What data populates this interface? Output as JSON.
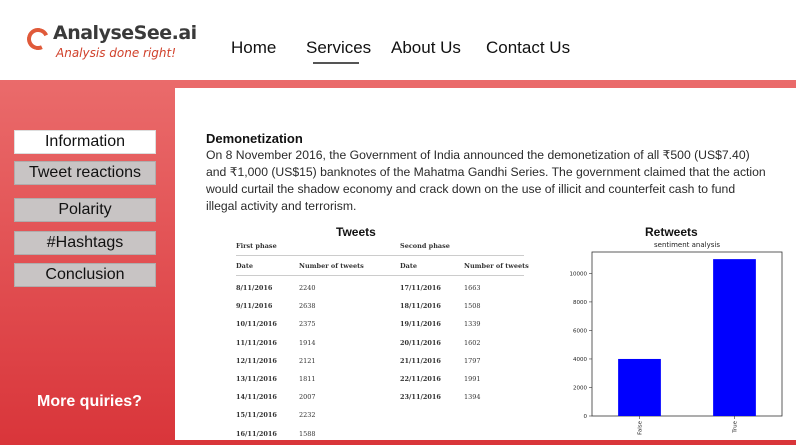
{
  "brand": {
    "name": "AnalyseSee.ai",
    "tagline": "Analysis done right!"
  },
  "nav": {
    "home": "Home",
    "services": "Services",
    "about": "About Us",
    "contact": "Contact Us",
    "active": "Services"
  },
  "sidebar": {
    "items": [
      {
        "label": "Information",
        "active": true
      },
      {
        "label": "Tweet reactions",
        "active": false
      },
      {
        "label": "Polarity",
        "active": false
      },
      {
        "label": "#Hashtags",
        "active": false
      },
      {
        "label": "Conclusion",
        "active": false
      }
    ],
    "more": "More quiries?"
  },
  "content": {
    "title": "Demonetization",
    "text": "On 8 November 2016, the Government of India announced the demonetization of all ₹500 (US$7.40) and ₹1,000 (US$15) banknotes of the Mahatma Gandhi Series. The government claimed that the action would curtail the shadow economy and crack down on the use of illicit and counterfeit cash to fund illegal activity and terrorism."
  },
  "tweets": {
    "title": "Tweets",
    "first_phase": "First phase",
    "second_phase": "Second phase",
    "col_date": "Date",
    "col_count": "Number of tweets",
    "first_rows": [
      [
        "8/11/2016",
        "2240"
      ],
      [
        "9/11/2016",
        "2638"
      ],
      [
        "10/11/2016",
        "2375"
      ],
      [
        "11/11/2016",
        "1914"
      ],
      [
        "12/11/2016",
        "2121"
      ],
      [
        "13/11/2016",
        "1811"
      ],
      [
        "14/11/2016",
        "2007"
      ],
      [
        "15/11/2016",
        "2232"
      ],
      [
        "16/11/2016",
        "1588"
      ]
    ],
    "second_rows": [
      [
        "17/11/2016",
        "1663"
      ],
      [
        "18/11/2016",
        "1508"
      ],
      [
        "19/11/2016",
        "1339"
      ],
      [
        "20/11/2016",
        "1602"
      ],
      [
        "21/11/2016",
        "1797"
      ],
      [
        "22/11/2016",
        "1991"
      ],
      [
        "23/11/2016",
        "1394"
      ]
    ]
  },
  "retweets": {
    "title": "Retweets"
  },
  "chart_data": {
    "type": "bar",
    "title": "sentiment analysis",
    "categories": [
      "False",
      "True"
    ],
    "values": [
      4000,
      11000
    ],
    "ylim": [
      0,
      11500
    ],
    "yticks": [
      0,
      2000,
      4000,
      6000,
      8000,
      10000
    ],
    "bar_color": "#0000ff"
  },
  "colors": {
    "accent": "#d9353a",
    "logo": "#e05a3a"
  }
}
